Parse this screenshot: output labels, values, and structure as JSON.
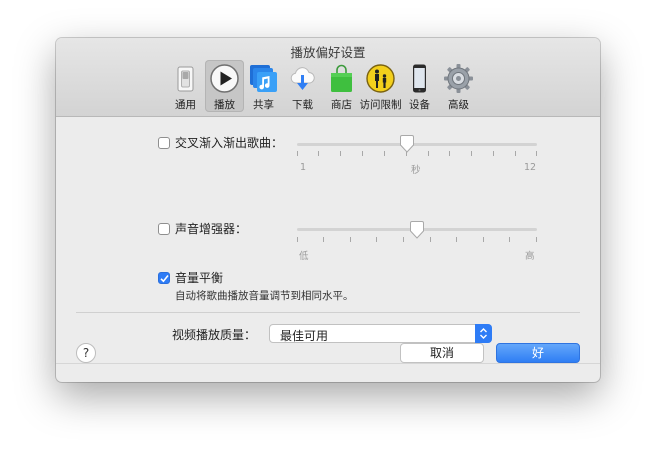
{
  "window": {
    "title": "播放偏好设置"
  },
  "toolbar": {
    "items": [
      {
        "label": "通用",
        "icon": "general-switch-icon"
      },
      {
        "label": "播放",
        "icon": "play-icon",
        "selected": true
      },
      {
        "label": "共享",
        "icon": "music-share-icon"
      },
      {
        "label": "下载",
        "icon": "cloud-download-icon"
      },
      {
        "label": "商店",
        "icon": "shopping-bag-icon"
      },
      {
        "label": "访问限制",
        "icon": "parental-restriction-icon"
      },
      {
        "label": "设备",
        "icon": "iphone-device-icon"
      },
      {
        "label": "高级",
        "icon": "gear-icon"
      }
    ]
  },
  "crossfade": {
    "label": "交叉渐入渐出歌曲：",
    "checked": false,
    "min_label": "1",
    "unit_label": "秒",
    "max_label": "12",
    "value": 6
  },
  "sound_enhancer": {
    "label": "声音增强器：",
    "checked": false,
    "min_label": "低",
    "max_label": "高",
    "value": 0.5
  },
  "sound_check": {
    "label": "音量平衡",
    "checked": true,
    "description": "自动将歌曲播放音量调节到相同水平。"
  },
  "video_quality": {
    "label": "视频播放质量：",
    "selected": "最佳可用"
  },
  "footer": {
    "help_label": "?",
    "cancel_label": "取消",
    "ok_label": "好"
  },
  "colors": {
    "accent": "#2e7cf6",
    "background": "#ececec"
  }
}
